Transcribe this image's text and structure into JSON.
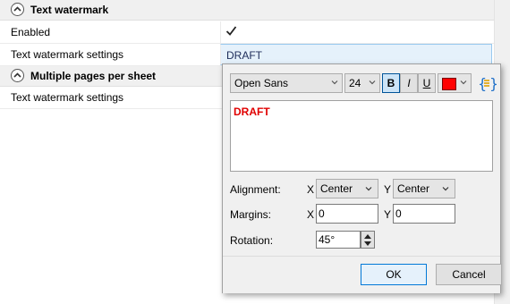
{
  "sections": {
    "text_watermark": "Text watermark",
    "multiple_pages": "Multiple pages per sheet"
  },
  "rows": {
    "enabled_label": "Enabled",
    "settings_label": "Text watermark settings",
    "settings_value": "DRAFT",
    "mps_settings_label": "Text watermark settings"
  },
  "popup": {
    "font_family": "Open Sans",
    "font_size": "24",
    "bold_label": "B",
    "italic_label": "I",
    "underline_label": "U",
    "text_color": "#ff0000",
    "editor_text": "DRAFT",
    "alignment_label": "Alignment:",
    "x_label": "X",
    "y_label": "Y",
    "align_x": "Center",
    "align_y": "Center",
    "margins_label": "Margins:",
    "margin_x": "0",
    "margin_y": "0",
    "rotation_label": "Rotation:",
    "rotation": "45°",
    "ok_label": "OK",
    "cancel_label": "Cancel"
  }
}
